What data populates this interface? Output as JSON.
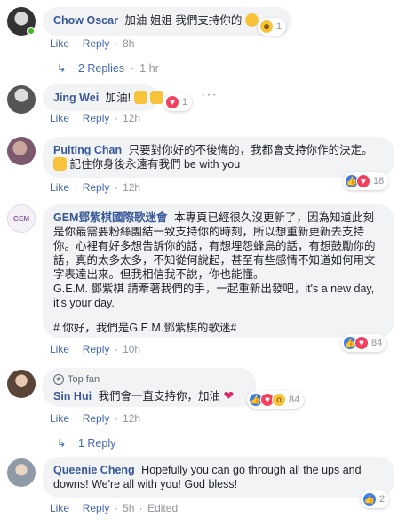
{
  "comments": [
    {
      "name": "Chow Oscar",
      "text": "加油 姐姐 我們支持你的",
      "reaction_count": "1",
      "actions": {
        "like": "Like",
        "reply": "Reply",
        "time": "8h"
      },
      "replies_label": "2 Replies",
      "replies_time": "1 hr"
    },
    {
      "name": "Jing Wei",
      "text": "加油!",
      "reaction_count": "1",
      "actions": {
        "like": "Like",
        "reply": "Reply",
        "time": "12h"
      }
    },
    {
      "name": "Puiting Chan",
      "text": "只要對你好的不後悔的，我都會支持你作的決定。",
      "text2": "記住你身後永遠有我們 be with you",
      "reaction_count": "18",
      "actions": {
        "like": "Like",
        "reply": "Reply",
        "time": "12h"
      }
    },
    {
      "name": "GEM鄧紫棋國際歌迷會",
      "text": "本專頁已經很久沒更新了，因為知道此刻是你最需要粉絲團結一致支持你的時刻，所以想重新更新去支持你。心裡有好多想告訴你的話，有想埋怨蜂鳥的話，有想鼓勵你的話，真的太多太多，不知從何說起，甚至有些感情不知道如何用文字表達出來。但我相信我不說，你也能懂。",
      "text2": "G.E.M. 鄧紫棋 請牽著我們的手，一起重新出發吧，it's a new day, it's your day.",
      "text3": "# 你好，我們是G.E.M.鄧紫棋的歌迷#",
      "reaction_count": "84",
      "actions": {
        "like": "Like",
        "reply": "Reply",
        "time": "10h"
      }
    },
    {
      "badge": "Top fan",
      "name": "Sin Hui",
      "text": "我們會一直支持你，加油",
      "reaction_count": "84",
      "actions": {
        "like": "Like",
        "reply": "Reply",
        "time": "12h"
      },
      "replies_label": "1 Reply"
    },
    {
      "name": "Queenie Cheng",
      "text": "Hopefully you can go through all the ups and downs! We're all with you! God bless!",
      "reaction_count": "2",
      "actions": {
        "like": "Like",
        "reply": "Reply",
        "time": "5h",
        "edited": "Edited"
      }
    }
  ],
  "sep": "·",
  "colors": {
    "link": "#4267b2",
    "name": "#385898",
    "bubble": "#f2f3f5",
    "meta": "#90949c"
  }
}
